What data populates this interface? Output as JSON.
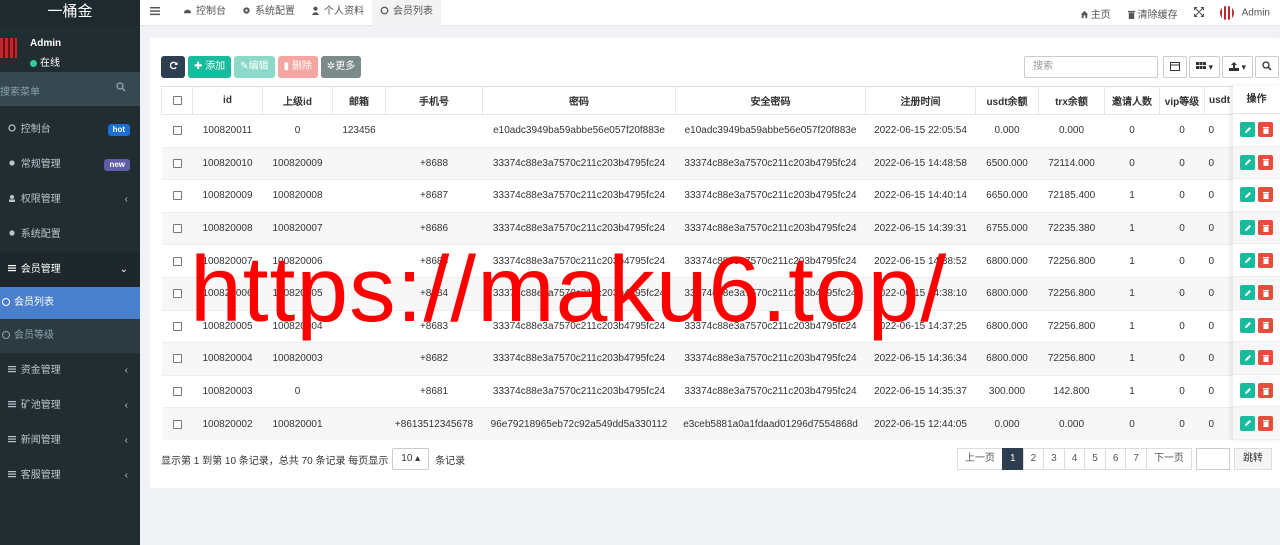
{
  "sidebar": {
    "brand": "一桶金",
    "user": {
      "name": "Admin",
      "status": "在线"
    },
    "search_placeholder": "搜索菜单",
    "menu": [
      {
        "label": "控制台",
        "badge": "hot",
        "badge_color": "#1a6fd6"
      },
      {
        "label": "常规管理",
        "badge": "new",
        "badge_color": "#605ca8"
      },
      {
        "label": "权限管理",
        "chevron": "‹"
      },
      {
        "label": "系统配置"
      },
      {
        "label": "会员管理",
        "chevron": "⌄"
      }
    ],
    "submenu": {
      "active": "会员列表",
      "other": "会员等级"
    },
    "menu_bottom": [
      {
        "label": "资金管理",
        "chevron": "‹"
      },
      {
        "label": "矿池管理",
        "chevron": "‹"
      },
      {
        "label": "新闻管理",
        "chevron": "‹"
      },
      {
        "label": "客服管理",
        "chevron": "‹"
      }
    ]
  },
  "topbar": {
    "tabs": [
      {
        "label": "控制台",
        "icon": "dashboard-icon"
      },
      {
        "label": "系统配置",
        "icon": "gear-icon"
      },
      {
        "label": "个人资料",
        "icon": "user-icon"
      },
      {
        "label": "会员列表",
        "icon": "circle-icon"
      }
    ],
    "right": {
      "home": "主页",
      "clear_cache": "清除缓存",
      "admin": "Admin"
    }
  },
  "toolbar": {
    "add": "添加",
    "edit": "编辑",
    "delete": "删除",
    "more": "更多"
  },
  "search": {
    "placeholder": "搜索"
  },
  "table": {
    "headers": [
      "id",
      "上级id",
      "邮箱",
      "手机号",
      "密码",
      "安全密码",
      "注册时间",
      "usdt余额",
      "trx余额",
      "邀请人数",
      "vip等级",
      "usdt"
    ],
    "rows": [
      [
        "100820011",
        "0",
        "123456",
        "",
        "e10adc3949ba59abbe56e057f20f883e",
        "e10adc3949ba59abbe56e057f20f883e",
        "2022-06-15 22:05:54",
        "0.000",
        "0.000",
        "0",
        "0",
        "0"
      ],
      [
        "100820010",
        "100820009",
        "",
        "+8688",
        "33374c88e3a7570c211c203b4795fc24",
        "33374c88e3a7570c211c203b4795fc24",
        "2022-06-15 14:48:58",
        "6500.000",
        "72114.000",
        "0",
        "0",
        "0"
      ],
      [
        "100820009",
        "100820008",
        "",
        "+8687",
        "33374c88e3a7570c211c203b4795fc24",
        "33374c88e3a7570c211c203b4795fc24",
        "2022-06-15 14:40:14",
        "6650.000",
        "72185.400",
        "1",
        "0",
        "0"
      ],
      [
        "100820008",
        "100820007",
        "",
        "+8686",
        "33374c88e3a7570c211c203b4795fc24",
        "33374c88e3a7570c211c203b4795fc24",
        "2022-06-15 14:39:31",
        "6755.000",
        "72235.380",
        "1",
        "0",
        "0"
      ],
      [
        "100820007",
        "100820006",
        "",
        "+8685",
        "33374c88e3a7570c211c203b4795fc24",
        "33374c88e3a7570c211c203b4795fc24",
        "2022-06-15 14:38:52",
        "6800.000",
        "72256.800",
        "1",
        "0",
        "0"
      ],
      [
        "100820006",
        "100820005",
        "",
        "+8684",
        "33374c88e3a7570c211c203b4795fc24",
        "33374c88e3a7570c211c203b4795fc24",
        "2022-06-15 14:38:10",
        "6800.000",
        "72256.800",
        "1",
        "0",
        "0"
      ],
      [
        "100820005",
        "100820004",
        "",
        "+8683",
        "33374c88e3a7570c211c203b4795fc24",
        "33374c88e3a7570c211c203b4795fc24",
        "2022-06-15 14:37:25",
        "6800.000",
        "72256.800",
        "1",
        "0",
        "0"
      ],
      [
        "100820004",
        "100820003",
        "",
        "+8682",
        "33374c88e3a7570c211c203b4795fc24",
        "33374c88e3a7570c211c203b4795fc24",
        "2022-06-15 14:36:34",
        "6800.000",
        "72256.800",
        "1",
        "0",
        "0"
      ],
      [
        "100820003",
        "0",
        "",
        "+8681",
        "33374c88e3a7570c211c203b4795fc24",
        "33374c88e3a7570c211c203b4795fc24",
        "2022-06-15 14:35:37",
        "300.000",
        "142.800",
        "1",
        "0",
        "0"
      ],
      [
        "100820002",
        "100820001",
        "",
        "+8613512345678",
        "96e79218965eb72c92a549dd5a330112",
        "e3ceb5881a0a1fdaad01296d7554868d",
        "2022-06-15 12:44:05",
        "0.000",
        "0.000",
        "0",
        "0",
        "0"
      ]
    ],
    "ops_header": "操作"
  },
  "footer": {
    "info_pre": "显示第 1 到第 10 条记录，总共 70 条记录 每页显示",
    "page_size": "10 ▴",
    "info_post": "条记录",
    "prev": "上一页",
    "pages": [
      "1",
      "2",
      "3",
      "4",
      "5",
      "6",
      "7"
    ],
    "next": "下一页",
    "go": "跳转"
  },
  "watermark": "https://maku6.top/"
}
